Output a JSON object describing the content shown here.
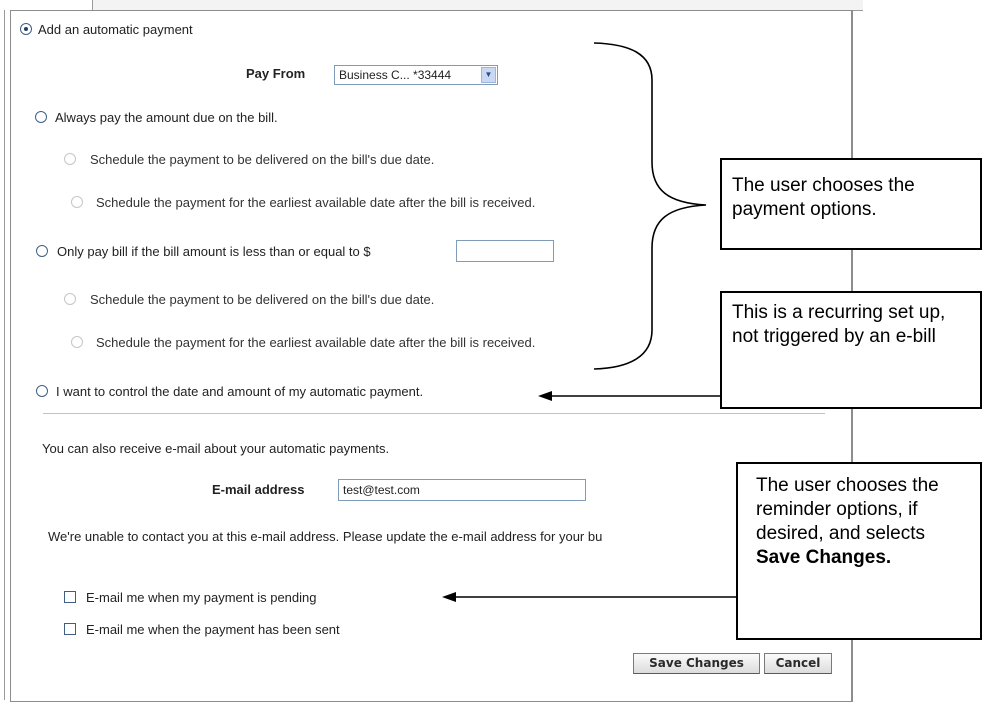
{
  "auto_payment": {
    "add_label": "Add an automatic payment",
    "pay_from_label": "Pay From",
    "pay_from_value": "Business C... *33444",
    "option_always": "Always pay the amount due on the bill.",
    "sub_due_date": "Schedule the payment to be delivered on the bill's due date.",
    "sub_earliest": "Schedule the payment for the earliest available date after the bill is received.",
    "option_only_if": "Only pay bill if the bill amount is less than or equal to $",
    "only_if_amount": "",
    "option_control": "I want to control the date and amount of my automatic payment."
  },
  "email": {
    "intro": "You can also receive e-mail about your automatic payments.",
    "address_label": "E-mail address",
    "address_value": "test@test.com",
    "warning": "We're unable to contact you at this e-mail address. Please update the e-mail address for your bu",
    "check_pending": "E-mail me when my payment is pending",
    "check_sent": "E-mail me when the payment has been sent"
  },
  "buttons": {
    "save": "Save Changes",
    "cancel": "Cancel"
  },
  "callouts": {
    "options": "The user chooses the payment options.",
    "recurring": "This is a recurring set up, not triggered by an e-bill",
    "reminder_prefix": "The user chooses the reminder options, if desired, and selects ",
    "reminder_bold": "Save Changes."
  }
}
